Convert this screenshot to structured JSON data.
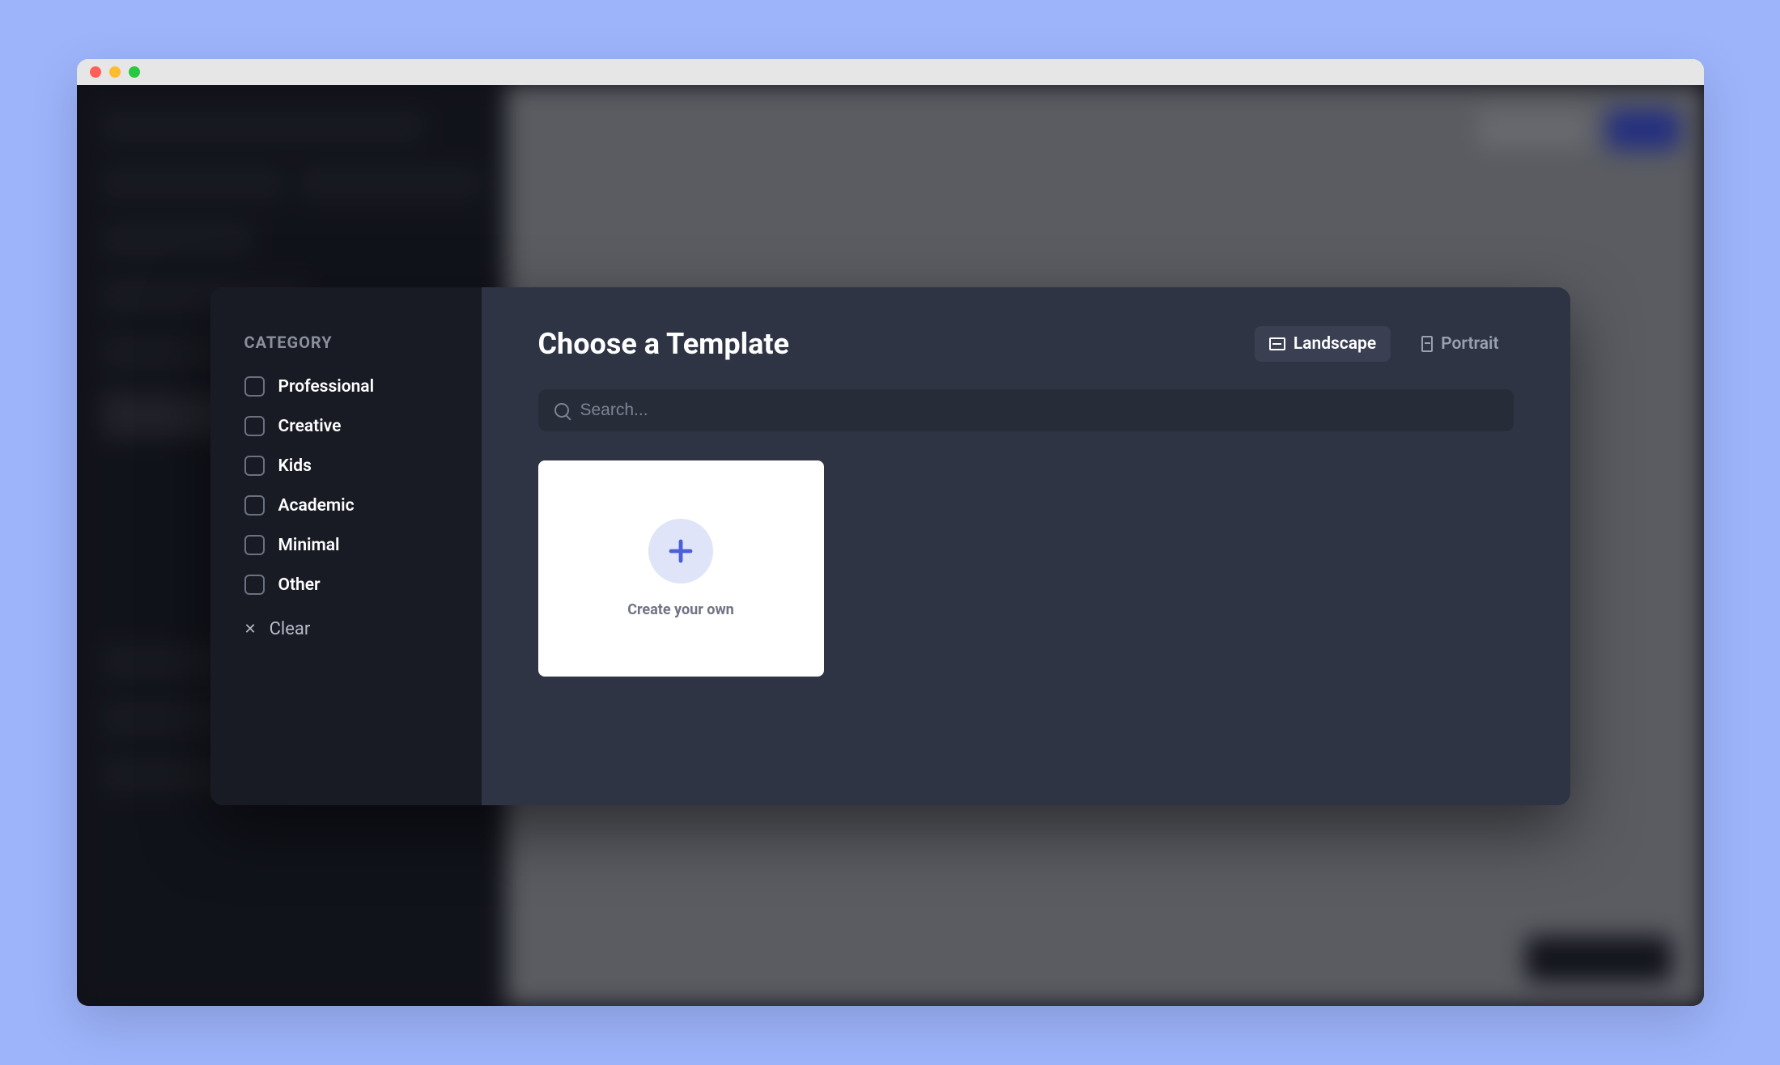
{
  "sidebar": {
    "title": "CATEGORY",
    "items": [
      {
        "label": "Professional"
      },
      {
        "label": "Creative"
      },
      {
        "label": "Kids"
      },
      {
        "label": "Academic"
      },
      {
        "label": "Minimal"
      },
      {
        "label": "Other"
      }
    ],
    "clear": "Clear"
  },
  "modal": {
    "title": "Choose a Template",
    "orientation": {
      "landscape": "Landscape",
      "portrait": "Portrait"
    },
    "search_placeholder": "Search...",
    "create_card_label": "Create your own"
  }
}
